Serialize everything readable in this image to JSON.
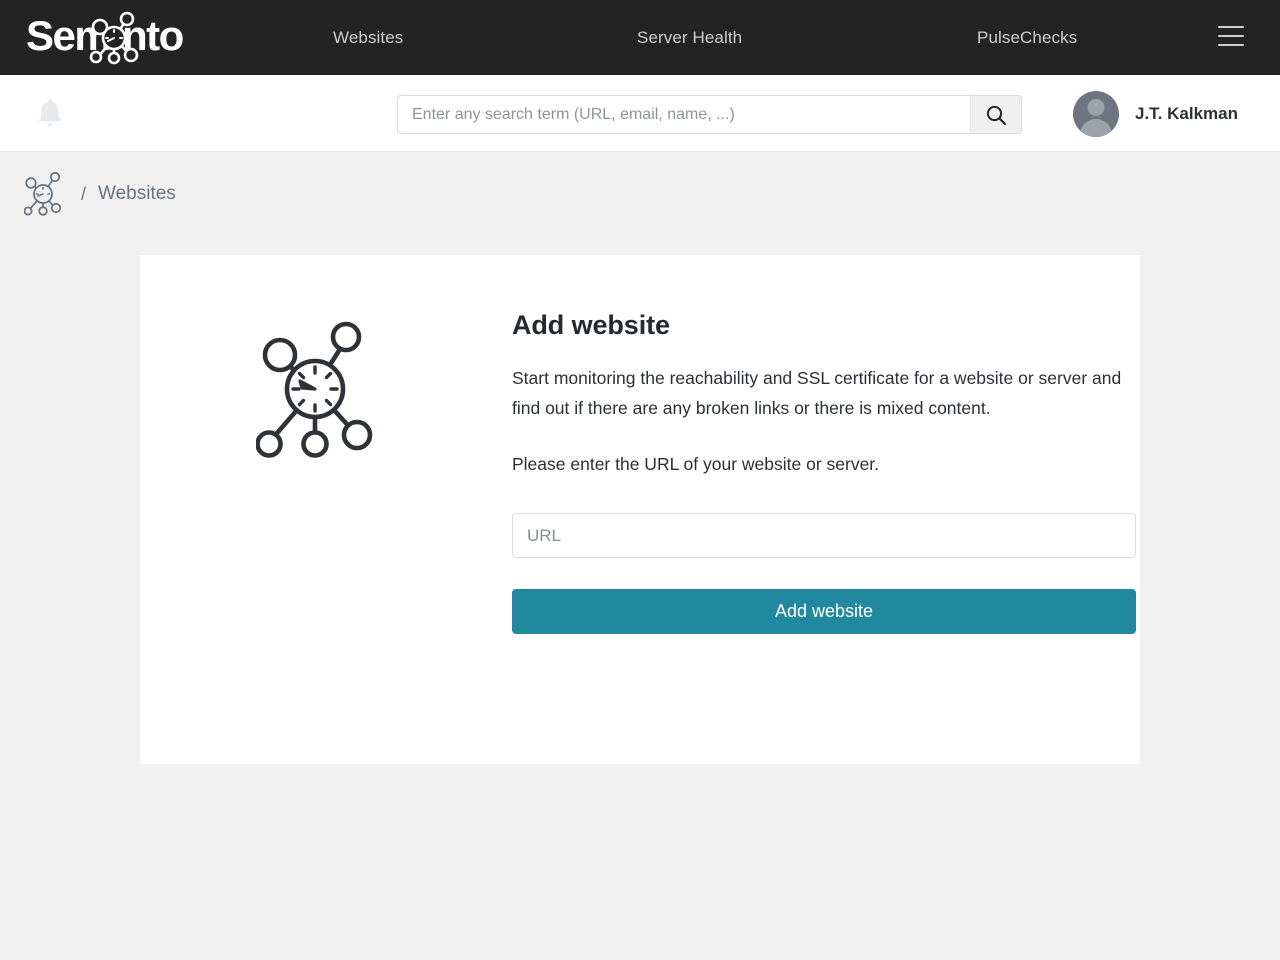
{
  "brand": {
    "name": "Semonto",
    "logo_icon": "network-gauge-icon"
  },
  "topnav": {
    "items": [
      {
        "label": "Websites",
        "name": "nav-websites"
      },
      {
        "label": "Server Health",
        "name": "nav-server-health"
      },
      {
        "label": "PulseChecks",
        "name": "nav-pulsechecks"
      }
    ],
    "menu_icon": "hamburger-menu-icon",
    "background": "#232323",
    "link_color": "#cfcfcf"
  },
  "subheader": {
    "notifications_icon": "bell-icon",
    "search": {
      "placeholder": "Enter any search term (URL, email, name, ...)",
      "value": "",
      "button_icon": "search-icon"
    },
    "user": {
      "name": "J.T. Kalkman",
      "avatar_icon": "user-avatar-placeholder"
    }
  },
  "breadcrumb": {
    "home_icon": "network-gauge-icon",
    "separator": "/",
    "current": "Websites"
  },
  "card": {
    "illustration_icon": "network-gauge-icon",
    "title": "Add website",
    "paragraph_1": "Start monitoring the reachability and SSL certificate for a website or server and find out if there are any broken links or there is mixed content.",
    "paragraph_2": "Please enter the URL of your website or server.",
    "url_field": {
      "placeholder": "URL",
      "value": ""
    },
    "submit_label": "Add website",
    "accent_color": "#21899f"
  },
  "page": {
    "background": "#f1f1f1",
    "card_background": "#ffffff"
  }
}
